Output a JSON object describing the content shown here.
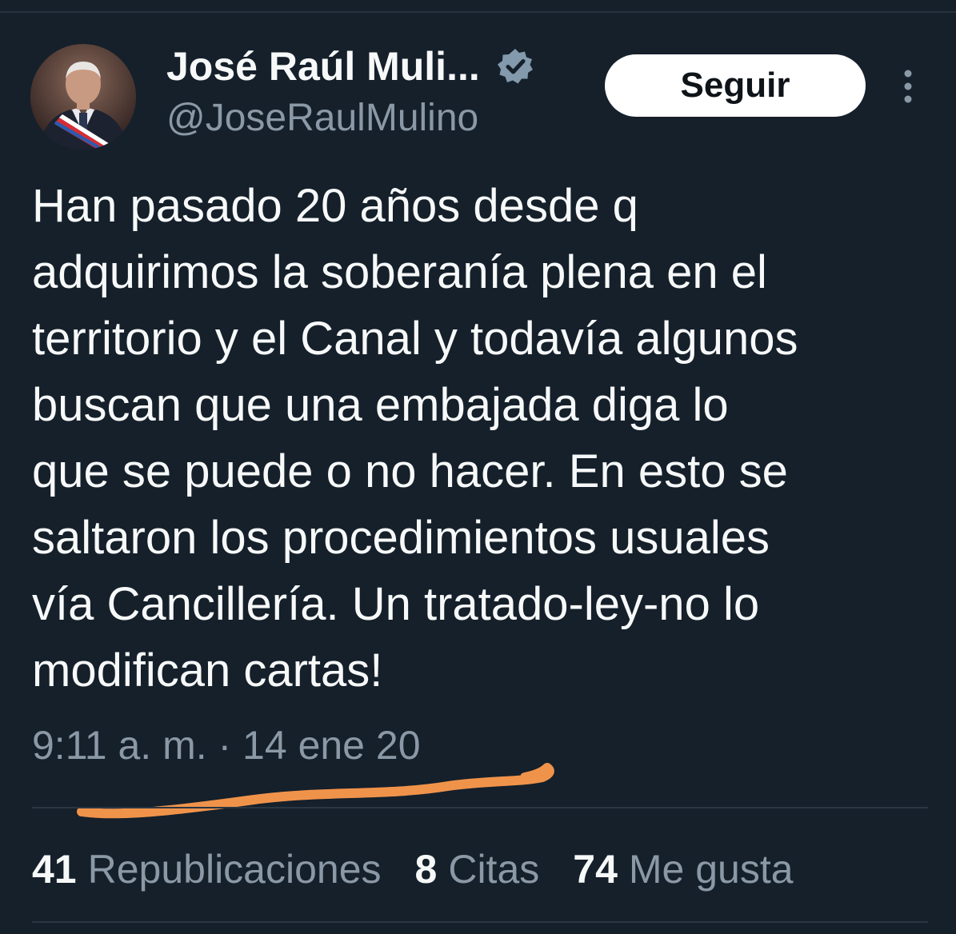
{
  "author": {
    "display_name": "José Raúl Muli...",
    "handle": "@JoseRaulMulino",
    "verified_icon": "verified-badge-icon",
    "avatar_icon": "profile-avatar"
  },
  "actions": {
    "follow_label": "Seguir",
    "more_icon": "more-vertical-icon"
  },
  "tweet": {
    "text": "Han pasado 20 años desde q\nadquirimos la soberanía plena en el\nterritorio y el Canal y todavía algunos\nbuscan que una embajada diga lo\nque se puede o no hacer. En esto se\nsaltaron los procedimientos usuales\nvía Cancillería. Un tratado-ley-no lo\nmodifican cartas!",
    "timestamp": "9:11 a. m. · 14 ene 20"
  },
  "stats": [
    {
      "count": "41",
      "label": "Republicaciones"
    },
    {
      "count": "8",
      "label": "Citas"
    },
    {
      "count": "74",
      "label": "Me gusta"
    }
  ],
  "colors": {
    "background": "#15202b",
    "primary_text": "#f7f9f9",
    "secondary_text": "#8b98a5",
    "follow_button_bg": "#ffffff",
    "verified_badge": "#829aab",
    "annotation_underline": "#f0934a"
  }
}
